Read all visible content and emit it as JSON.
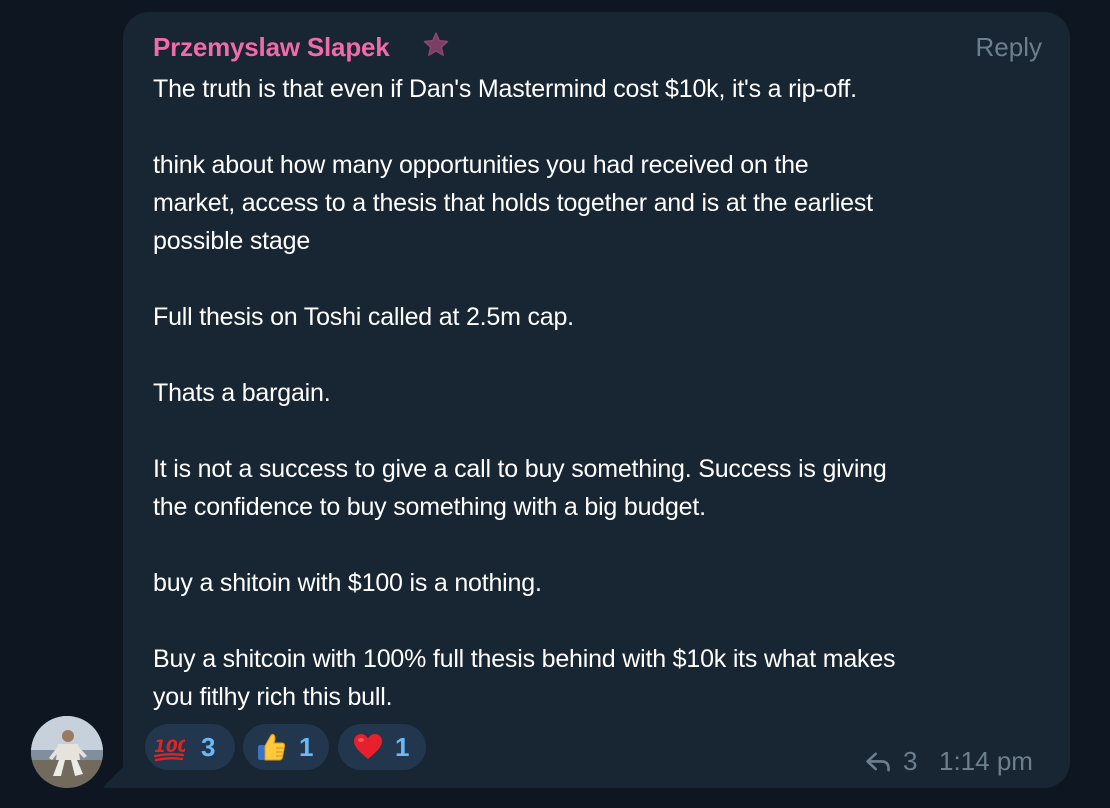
{
  "message": {
    "sender": "Przemyslaw Slapek",
    "reply_label": "Reply",
    "paragraphs": [
      [
        "The truth is that even if Dan's Mastermind cost $10k, it's a rip-off."
      ],
      [
        "think about how many opportunities you had received on the",
        "market, access to a thesis that holds together and is at the earliest",
        "possible stage"
      ],
      [
        "Full thesis on Toshi called at 2.5m cap."
      ],
      [
        "Thats a bargain."
      ],
      [
        "It is not a success to give a call to buy something. Success is giving",
        "the confidence to buy something with a big budget."
      ],
      [
        "buy a shitoin with $100 is a nothing."
      ],
      [
        "Buy a shitcoin with 100% full thesis behind with $10k its what makes",
        "you fitlhy rich this bull."
      ]
    ],
    "reactions": [
      {
        "emoji": "hundred-points-icon",
        "count": "3"
      },
      {
        "emoji": "thumbs-up-icon",
        "count": "1"
      },
      {
        "emoji": "red-heart-icon",
        "count": "1"
      }
    ],
    "reply_count": "3",
    "time": "1:14 pm"
  },
  "colors": {
    "background": "#0e1621",
    "bubble": "#182533",
    "sender_name": "#f06ba8",
    "muted": "#6d7f8f",
    "reaction_bg": "#22364d",
    "reaction_count": "#6ab8f7"
  }
}
